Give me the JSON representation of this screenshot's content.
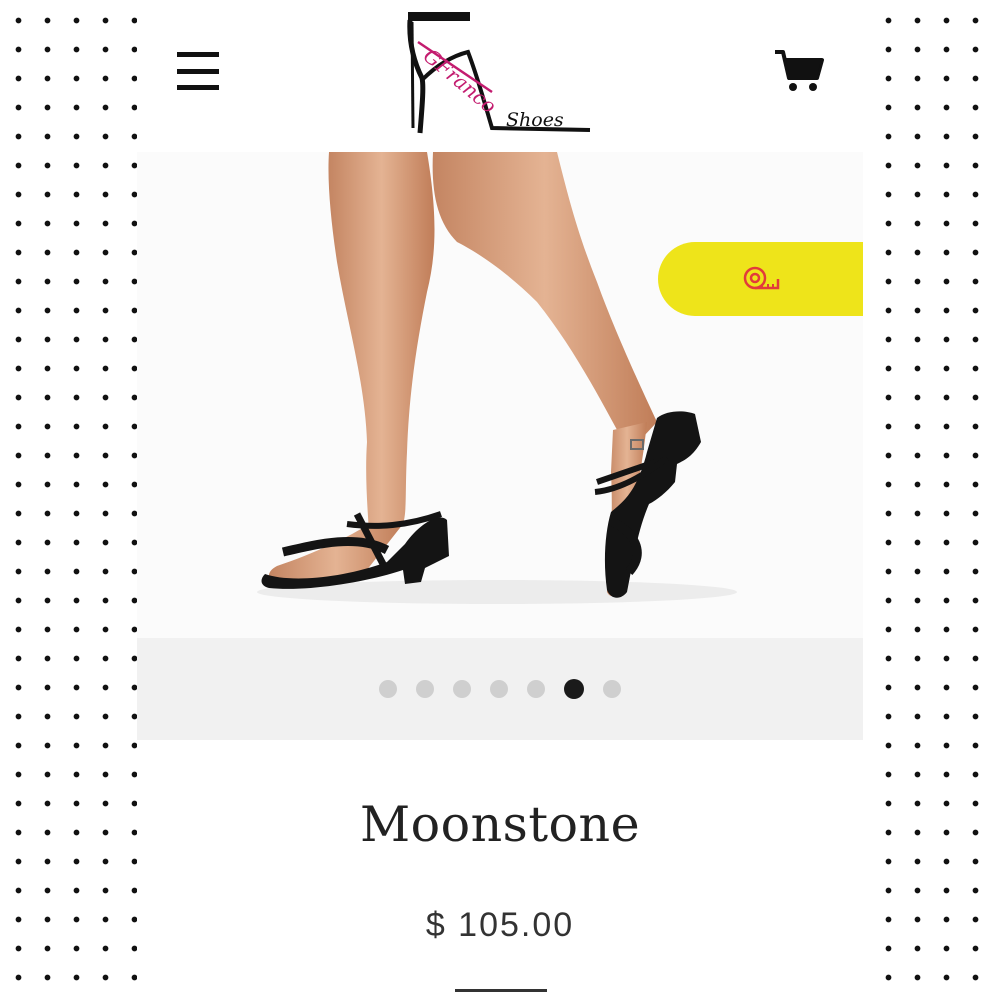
{
  "header": {
    "menu_icon": "hamburger-menu-icon",
    "logo_text": "GFranco Shoes",
    "cart_icon": "shopping-cart-icon"
  },
  "gallery": {
    "image": "woman-legs-black-strappy-dance-sandals-photo",
    "slides": 7,
    "active_slide": 6
  },
  "size_guide": {
    "icon": "tape-measure-icon",
    "background": "#eee41a",
    "icon_color": "#e23b3b"
  },
  "product": {
    "title": "Moonstone",
    "price": "$ 105.00"
  }
}
